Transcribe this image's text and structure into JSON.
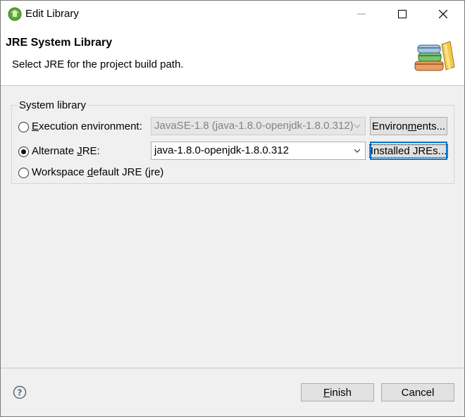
{
  "window": {
    "title": "Edit Library",
    "minimize_icon": "minimize-icon",
    "maximize_icon": "maximize-icon",
    "close_icon": "close-icon"
  },
  "header": {
    "title": "JRE System Library",
    "message": "Select JRE for the project build path.",
    "image_icon": "books-icon"
  },
  "system_library": {
    "group_label": "System library",
    "options": [
      {
        "label_pre": "",
        "label_mnemonic": "E",
        "label_post": "xecution environment:",
        "checked": false,
        "combo_value": "JavaSE-1.8 (java-1.8.0-openjdk-1.8.0.312)",
        "combo_disabled": true,
        "button_pre": "Environ",
        "button_mnemonic": "m",
        "button_post": "ents..."
      },
      {
        "label_pre": "Alternate ",
        "label_mnemonic": "J",
        "label_post": "RE:",
        "checked": true,
        "combo_value": "java-1.8.0-openjdk-1.8.0.312",
        "combo_disabled": false,
        "button_pre": "Installed JREs...",
        "button_mnemonic": "",
        "button_post": ""
      },
      {
        "label_pre": "Workspace ",
        "label_mnemonic": "d",
        "label_post": "efault JRE (jre)",
        "checked": false
      }
    ]
  },
  "footer": {
    "help_icon": "help-icon",
    "finish_mnemonic": "F",
    "finish_rest": "inish",
    "cancel_label": "Cancel"
  }
}
